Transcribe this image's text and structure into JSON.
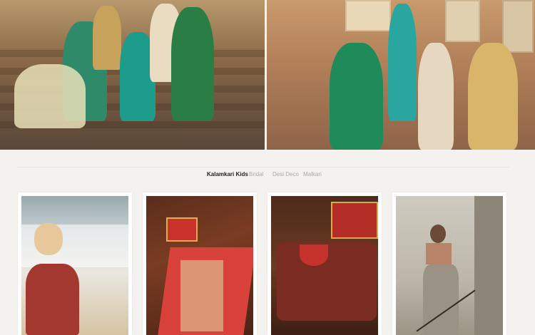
{
  "hero": {
    "left_alt": "Women and girls in green and teal ethnic wear on palace steps",
    "right_alt": "Women and girls posing against sandstone palace wall"
  },
  "tabs": [
    {
      "label": "Kalamkari Kids",
      "active": true
    },
    {
      "label": "Bridal",
      "active": false
    },
    {
      "label": "Desi Deco",
      "active": false
    },
    {
      "label": "Malkari",
      "active": false
    }
  ],
  "gallery": {
    "items": [
      {
        "alt": "Girl in floral dress at the beach"
      },
      {
        "alt": "Red kalamkari dress with gift box on wooden floor"
      },
      {
        "alt": "Kalamkari blouse with red gift box"
      },
      {
        "alt": "Girl in crop top and dhoti pants on stairs"
      }
    ]
  },
  "colors": {
    "background": "#f3f2ef",
    "tab_active": "#222222",
    "tab_inactive": "#a9a9a9"
  }
}
